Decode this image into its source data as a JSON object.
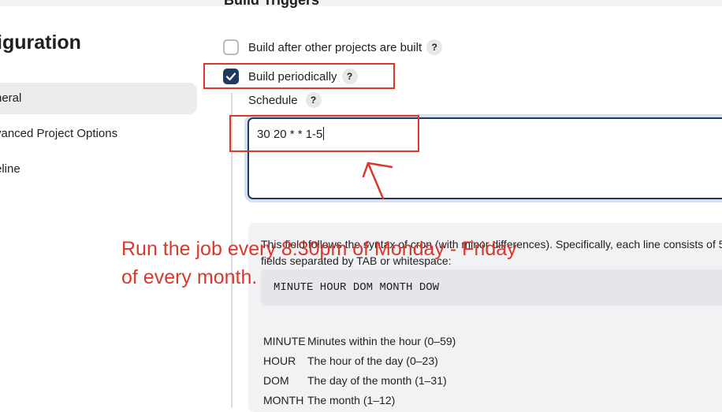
{
  "sidebar": {
    "title": "iguration",
    "items": [
      {
        "label": "neral",
        "active": true
      },
      {
        "label": "vanced Project Options",
        "active": false
      },
      {
        "label": "eline",
        "active": false
      }
    ]
  },
  "section": {
    "title": "Build Triggers"
  },
  "triggers": {
    "after_other": {
      "label": "Build after other projects are built",
      "checked": false
    },
    "periodically": {
      "label": "Build periodically",
      "checked": true
    }
  },
  "help_icon_text": "?",
  "schedule": {
    "label": "Schedule",
    "value": "30 20 * * 1-5"
  },
  "help": {
    "intro": "This field follows the syntax of cron (with minor differences). Specifically, each line consists of 5 fields separated by TAB or whitespace:",
    "code": "MINUTE HOUR DOM MONTH DOW",
    "fields": [
      {
        "key": "MINUTE",
        "desc": "Minutes within the hour (0–59)"
      },
      {
        "key": "HOUR",
        "desc": "The hour of the day (0–23)"
      },
      {
        "key": "DOM",
        "desc": "The day of the month (1–31)"
      },
      {
        "key": "MONTH",
        "desc": "The month (1–12)"
      }
    ]
  },
  "annotation": {
    "line1": "Run the job every 8:30pm of Monday - Friday",
    "line2": "of every month.",
    "color": "#d9382c"
  },
  "colors": {
    "accent": "#1e3a5f",
    "panel": "#f2f2f4"
  }
}
